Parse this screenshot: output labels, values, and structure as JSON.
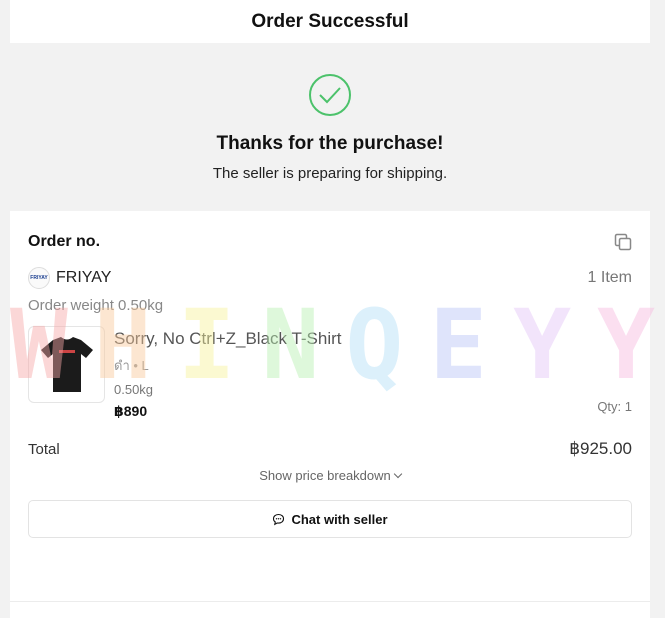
{
  "header": {
    "title": "Order Successful"
  },
  "success": {
    "headline": "Thanks for the purchase!",
    "subtext": "The seller is preparing for shipping."
  },
  "order": {
    "label": "Order no.",
    "shop_logo_text": "FRIYAY",
    "shop_name": "FRIYAY",
    "item_count": "1 Item",
    "weight": "Order weight 0.50kg",
    "product": {
      "name": "Sorry, No Ctrl+Z_Black T-Shirt",
      "variant": "ดำ • L",
      "weight": "0.50kg",
      "price": "฿890",
      "qty": "Qty: 1"
    },
    "total_label": "Total",
    "total_value": "฿925.00",
    "breakdown_label": "Show price breakdown",
    "chat_label": "Chat with seller"
  },
  "watermark": {
    "text": [
      "W",
      "H",
      "I",
      "N",
      "Q",
      "E",
      "Y",
      "Y"
    ],
    "colors": [
      "#f7a7a7",
      "#f9c99a",
      "#f7f39a",
      "#b8f0b0",
      "#b3e0f7",
      "#b9c4f7",
      "#e4c4f7",
      "#f7b9e0"
    ]
  },
  "colors": {
    "accent_check": "#4cc26b"
  }
}
